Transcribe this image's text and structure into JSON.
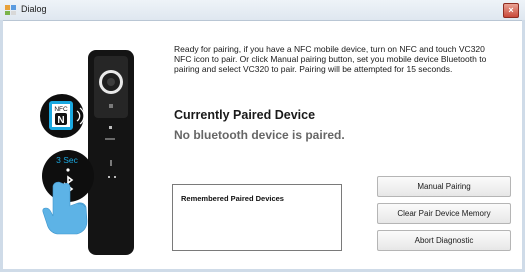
{
  "window": {
    "title": "Dialog",
    "close_glyph": "×"
  },
  "icons": {
    "app": "app-icon",
    "nfc": "nfc-icon",
    "bluetooth": "bluetooth-icon",
    "tap": "tap-hand-icon",
    "signal": "signal-waves-icon"
  },
  "illustration": {
    "nfc_badge": "NFC",
    "nfc_letter": "N",
    "timer_label": "3 Sec"
  },
  "main": {
    "instructions": "Ready for pairing, if you have a NFC mobile device, turn on NFC and touch VC320 NFC icon to pair. Or click Manual pairing button, set you mobile device Bluetooth to pairing and select VC320 to pair. Pairing will be attempted for 15 seconds.",
    "paired_title": "Currently Paired Device",
    "paired_status": "No bluetooth device is paired."
  },
  "remembered": {
    "header": "Remembered Paired Devices"
  },
  "buttons": {
    "manual_pairing": "Manual Pairing",
    "clear_memory": "Clear Pair Device Memory",
    "abort": "Abort Diagnostic"
  },
  "colors": {
    "accent_blue": "#1aa8e0",
    "device_black": "#141414"
  }
}
